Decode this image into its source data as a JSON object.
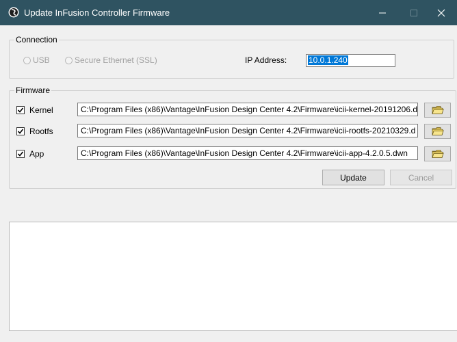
{
  "window": {
    "title": "Update InFusion Controller Firmware",
    "colors": {
      "titlebar": "#2f5361",
      "selection": "#0078d7"
    }
  },
  "connection": {
    "legend": "Connection",
    "usb_label": "USB",
    "ssl_label": "Secure Ethernet (SSL)",
    "ip_label": "IP Address:",
    "ip_value": "10.0.1.240"
  },
  "firmware": {
    "legend": "Firmware",
    "items": [
      {
        "label": "Kernel",
        "checked": true,
        "path": "C:\\Program Files (x86)\\Vantage\\InFusion Design Center 4.2\\Firmware\\icii-kernel-20191206.d"
      },
      {
        "label": "Rootfs",
        "checked": true,
        "path": "C:\\Program Files (x86)\\Vantage\\InFusion Design Center 4.2\\Firmware\\icii-rootfs-20210329.d"
      },
      {
        "label": "App",
        "checked": true,
        "path": "C:\\Program Files (x86)\\Vantage\\InFusion Design Center 4.2\\Firmware\\icii-app-4.2.0.5.dwn"
      }
    ],
    "browse_icon": "folder-icon"
  },
  "actions": {
    "update_label": "Update",
    "cancel_label": "Cancel"
  }
}
